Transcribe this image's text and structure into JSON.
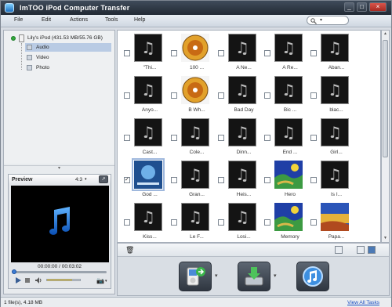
{
  "window": {
    "title": "ImTOO iPod Computer Transfer",
    "min": "_",
    "max": "□",
    "close": "×"
  },
  "menu": [
    "File",
    "Edit",
    "Actions",
    "Tools",
    "Help"
  ],
  "search": {
    "placeholder": ""
  },
  "tree": {
    "device": "Lily's iPod (431.53 MB/55.76 GB)",
    "items": [
      {
        "label": "Audio",
        "selected": true
      },
      {
        "label": "Video",
        "selected": false
      },
      {
        "label": "Photo",
        "selected": false
      }
    ]
  },
  "preview": {
    "title": "Preview",
    "ratio": "4:3",
    "time": "00:00:00 / 00:03:02",
    "volume": 0.75,
    "progress": 0
  },
  "media": [
    {
      "caption": "\"Thi...",
      "thumb": "note",
      "checked": false
    },
    {
      "caption": "100 ...",
      "thumb": "cd",
      "checked": false
    },
    {
      "caption": "A Ne...",
      "thumb": "note",
      "checked": false
    },
    {
      "caption": "A Re...",
      "thumb": "note",
      "checked": false
    },
    {
      "caption": "Aban...",
      "thumb": "note",
      "checked": false
    },
    {
      "caption": "Anyo...",
      "thumb": "note",
      "checked": false
    },
    {
      "caption": "B Wh...",
      "thumb": "cd",
      "checked": false
    },
    {
      "caption": "Bad Day",
      "thumb": "note",
      "checked": false
    },
    {
      "caption": "Bic ...",
      "thumb": "note",
      "checked": false
    },
    {
      "caption": "blac...",
      "thumb": "note",
      "checked": false
    },
    {
      "caption": "Cast...",
      "thumb": "note",
      "checked": false
    },
    {
      "caption": "Cole...",
      "thumb": "note",
      "checked": false
    },
    {
      "caption": "Dinn...",
      "thumb": "note",
      "checked": false
    },
    {
      "caption": "End ...",
      "thumb": "note",
      "checked": false
    },
    {
      "caption": "Girl...",
      "thumb": "note",
      "checked": false
    },
    {
      "caption": "God ...",
      "thumb": "selected",
      "checked": true
    },
    {
      "caption": "Gran...",
      "thumb": "note",
      "checked": false
    },
    {
      "caption": "Heis...",
      "thumb": "note",
      "checked": false
    },
    {
      "caption": "Hero",
      "thumb": "painting",
      "checked": false
    },
    {
      "caption": "Is I...",
      "thumb": "note",
      "checked": false
    },
    {
      "caption": "Kiss...",
      "thumb": "note",
      "checked": false
    },
    {
      "caption": "Le F...",
      "thumb": "note",
      "checked": false
    },
    {
      "caption": "Losi...",
      "thumb": "note",
      "checked": false
    },
    {
      "caption": "Memory",
      "thumb": "painting",
      "checked": false
    },
    {
      "caption": "Papa...",
      "thumb": "painting2",
      "checked": false
    }
  ],
  "status": {
    "left": "1 file(s), 4.18 MB",
    "right": "View All Tasks"
  },
  "icons": {
    "trash": "trash-icon",
    "note": "music-note-icon"
  }
}
